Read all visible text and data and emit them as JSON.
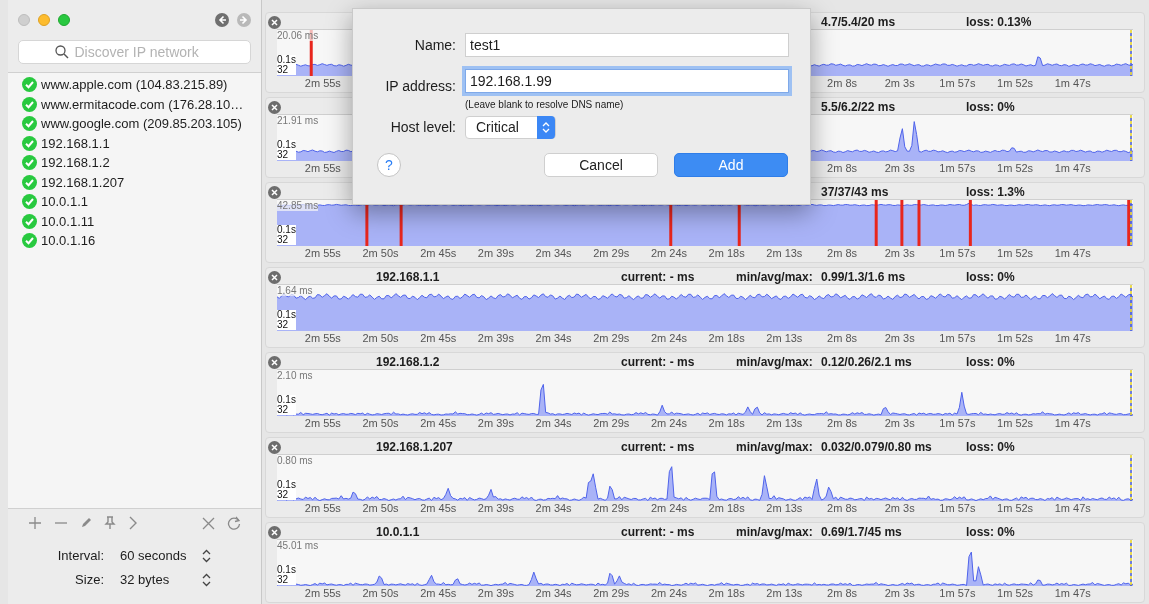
{
  "sidebar": {
    "search": {
      "placeholder": "Discover IP network"
    },
    "hosts": [
      {
        "label": "www.apple.com (104.83.215.89)"
      },
      {
        "label": "www.ermitacode.com (176.28.10…"
      },
      {
        "label": "www.google.com (209.85.203.105)"
      },
      {
        "label": "192.168.1.1"
      },
      {
        "label": "192.168.1.2"
      },
      {
        "label": "192.168.1.207"
      },
      {
        "label": "10.0.1.1"
      },
      {
        "label": "10.0.1.11"
      },
      {
        "label": "10.0.1.16"
      }
    ],
    "settings": [
      {
        "label": "Interval:",
        "value": "60 seconds"
      },
      {
        "label": "Size:",
        "value": "32 bytes"
      }
    ]
  },
  "monitors": [
    {
      "stats": "4.7/5.4/20 ms",
      "loss": "loss: 0.13%",
      "max": "20.06 ms",
      "timeout": "0.1s",
      "size": "32",
      "ticks_left": [
        "2m 55s"
      ],
      "ticks_right": [
        "2m 8s",
        "2m 3s",
        "1m 57s",
        "1m 52s",
        "1m 47s"
      ]
    },
    {
      "stats": "5.5/6.2/22 ms",
      "loss": "loss: 0%",
      "max": "21.91 ms",
      "timeout": "0.1s",
      "size": "32",
      "ticks_left": [
        "2m 55s"
      ],
      "ticks_right": [
        "2m 8s",
        "2m 3s",
        "1m 57s",
        "1m 52s",
        "1m 47s"
      ]
    },
    {
      "stats": "37/37/43 ms",
      "loss": "loss: 1.3%",
      "max": "42.85 ms",
      "timeout": "0.1s",
      "size": "32",
      "ticks_left": [
        "2m 55s",
        "2m 50s",
        "2m 45s",
        "2m 39s",
        "2m 34s",
        "2m 29s",
        "2m 24s",
        "2m 18s",
        "2m 13s",
        "2m 8s",
        "2m 3s",
        "1m 57s",
        "1m 52s",
        "1m 47s"
      ]
    },
    {
      "name": "192.168.1.1",
      "current": "current: - ms",
      "stats_label": "min/avg/max:",
      "stats": "0.99/1.3/1.6 ms",
      "loss": "loss: 0%",
      "max": "1.64 ms",
      "timeout": "0.1s",
      "size": "32",
      "ticks_left": [
        "2m 55s",
        "2m 50s",
        "2m 45s",
        "2m 39s",
        "2m 34s",
        "2m 29s",
        "2m 24s",
        "2m 18s",
        "2m 13s",
        "2m 8s",
        "2m 3s",
        "1m 57s",
        "1m 52s",
        "1m 47s"
      ]
    },
    {
      "name": "192.168.1.2",
      "current": "current: - ms",
      "stats_label": "min/avg/max:",
      "stats": "0.12/0.26/2.1 ms",
      "loss": "loss: 0%",
      "max": "2.10 ms",
      "timeout": "0.1s",
      "size": "32",
      "ticks_left": [
        "2m 55s",
        "2m 50s",
        "2m 45s",
        "2m 39s",
        "2m 34s",
        "2m 29s",
        "2m 24s",
        "2m 18s",
        "2m 13s",
        "2m 8s",
        "2m 3s",
        "1m 57s",
        "1m 52s",
        "1m 47s"
      ]
    },
    {
      "name": "192.168.1.207",
      "current": "current: - ms",
      "stats_label": "min/avg/max:",
      "stats": "0.032/0.079/0.80 ms",
      "loss": "loss: 0%",
      "max": "0.80 ms",
      "timeout": "0.1s",
      "size": "32",
      "ticks_left": [
        "2m 55s",
        "2m 50s",
        "2m 45s",
        "2m 39s",
        "2m 34s",
        "2m 29s",
        "2m 24s",
        "2m 18s",
        "2m 13s",
        "2m 8s",
        "2m 3s",
        "1m 57s",
        "1m 52s",
        "1m 47s"
      ]
    },
    {
      "name": "10.0.1.1",
      "current": "current: - ms",
      "stats_label": "min/avg/max:",
      "stats": "0.69/1.7/45 ms",
      "loss": "loss: 0%",
      "max": "45.01 ms",
      "timeout": "0.1s",
      "size": "32",
      "ticks_left": [
        "2m 55s",
        "2m 50s",
        "2m 45s",
        "2m 39s",
        "2m 34s",
        "2m 29s",
        "2m 24s",
        "2m 18s",
        "2m 13s",
        "2m 8s",
        "2m 3s",
        "1m 57s",
        "1m 52s",
        "1m 47s"
      ]
    }
  ],
  "dialog": {
    "fields": [
      {
        "label": "Name:",
        "value": "test1",
        "focused": false
      },
      {
        "label": "IP address:",
        "value": "192.168.1.99",
        "focused": true,
        "hint": "(Leave blank to resolve DNS name)"
      }
    ],
    "host_level": {
      "label": "Host level:",
      "value": "Critical"
    },
    "help": "?",
    "buttons": [
      {
        "label": "Cancel",
        "default": false
      },
      {
        "label": "Add",
        "default": true
      }
    ]
  }
}
